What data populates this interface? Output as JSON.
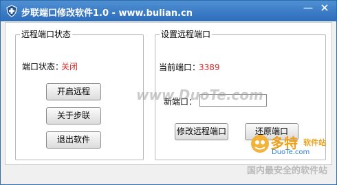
{
  "window": {
    "title": "步联端口修改软件1.0 - www.bulian.cn",
    "minimize_symbol": "—",
    "close_symbol": "✕",
    "icon": "shield-icon"
  },
  "remote_status": {
    "group_title": "远程端口状态",
    "status_label": "端口状态：",
    "status_value": "关闭",
    "buttons": {
      "enable": "开启远程",
      "about": "关于步联",
      "exit": "退出软件"
    }
  },
  "port_settings": {
    "group_title": "设置远程端口",
    "current_label": "当前端口：",
    "current_value": "3389",
    "new_label": "新端口：",
    "new_value": "",
    "buttons": {
      "modify": "修改远程端口",
      "restore": "还原端口"
    }
  },
  "watermark": {
    "center_text": "www.DuoTe.com",
    "brand": "多特",
    "brand_sub": "软件站",
    "url": "DuoTe.com",
    "slogan": "国内最安全的软件站"
  },
  "colors": {
    "title_bar": "#2d6dbb",
    "status_off": "#d62b2b",
    "port_value": "#d62b2b",
    "watermark_brand": "#f0a01a"
  }
}
